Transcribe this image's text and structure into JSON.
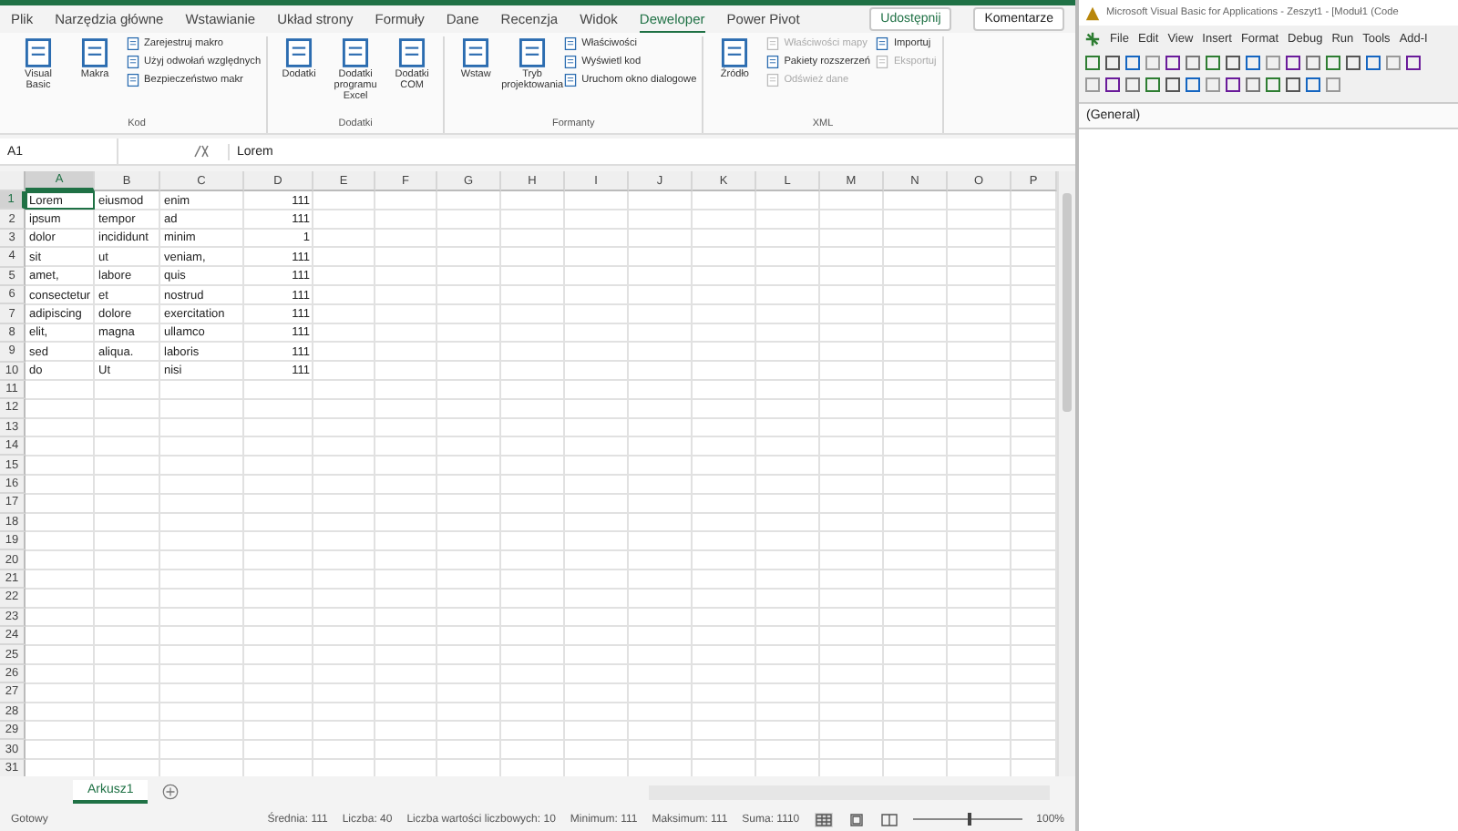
{
  "ribbon_tabs": [
    {
      "label": "Plik",
      "selected": false
    },
    {
      "label": "Narzędzia główne",
      "selected": false
    },
    {
      "label": "Wstawianie",
      "selected": false
    },
    {
      "label": "Układ strony",
      "selected": false
    },
    {
      "label": "Formuły",
      "selected": false
    },
    {
      "label": "Dane",
      "selected": false
    },
    {
      "label": "Recenzja",
      "selected": false
    },
    {
      "label": "Widok",
      "selected": false
    },
    {
      "label": "Deweloper",
      "selected": true
    },
    {
      "label": "Power Pivot",
      "selected": false
    }
  ],
  "share_button": "Udostępnij",
  "comments_button": "Komentarze",
  "ribbon_groups": [
    {
      "label": "Kod",
      "items": [
        {
          "label": "Visual Basic",
          "kind": "large",
          "disabled": false
        },
        {
          "label": "Makra",
          "kind": "large",
          "disabled": false
        },
        {
          "label": "Zarejestruj makro",
          "kind": "small",
          "disabled": false
        },
        {
          "label": "Użyj odwołań względnych",
          "kind": "small",
          "disabled": false
        },
        {
          "label": "Bezpieczeństwo makr",
          "kind": "small",
          "disabled": false
        }
      ]
    },
    {
      "label": "Dodatki",
      "items": [
        {
          "label": "Dodatki",
          "kind": "large",
          "disabled": false
        },
        {
          "label": "Dodatki programu Excel",
          "kind": "large",
          "disabled": false
        },
        {
          "label": "Dodatki COM",
          "kind": "large",
          "disabled": false
        }
      ]
    },
    {
      "label": "Formanty",
      "items": [
        {
          "label": "Wstaw",
          "kind": "large",
          "disabled": false
        },
        {
          "label": "Tryb projektowania",
          "kind": "large",
          "disabled": false
        },
        {
          "label": "Właściwości",
          "kind": "small",
          "disabled": false
        },
        {
          "label": "Wyświetl kod",
          "kind": "small",
          "disabled": false
        },
        {
          "label": "Uruchom okno dialogowe",
          "kind": "small",
          "disabled": false
        }
      ]
    },
    {
      "label": "XML",
      "items": [
        {
          "label": "Źródło",
          "kind": "large",
          "disabled": false
        },
        {
          "label": "Właściwości mapy",
          "kind": "small",
          "disabled": true
        },
        {
          "label": "Pakiety rozszerzeń",
          "kind": "small",
          "disabled": false
        },
        {
          "label": "Odśwież dane",
          "kind": "small",
          "disabled": true
        },
        {
          "label": "Importuj",
          "kind": "small",
          "disabled": false
        },
        {
          "label": "Eksportuj",
          "kind": "small",
          "disabled": true
        }
      ]
    }
  ],
  "formula_bar": {
    "name_box": "A1",
    "value": "Lorem"
  },
  "columns": [
    {
      "label": "A",
      "selected": true
    },
    {
      "label": "B",
      "selected": false
    },
    {
      "label": "C",
      "selected": false
    },
    {
      "label": "D",
      "selected": false
    },
    {
      "label": "E",
      "selected": false
    },
    {
      "label": "F",
      "selected": false
    },
    {
      "label": "G",
      "selected": false
    },
    {
      "label": "H",
      "selected": false
    },
    {
      "label": "I",
      "selected": false
    },
    {
      "label": "J",
      "selected": false
    },
    {
      "label": "K",
      "selected": false
    },
    {
      "label": "L",
      "selected": false
    },
    {
      "label": "M",
      "selected": false
    },
    {
      "label": "N",
      "selected": false
    },
    {
      "label": "O",
      "selected": false
    },
    {
      "label": "P",
      "selected": false
    }
  ],
  "rows": [
    {
      "number": "1",
      "selected": true,
      "cells": [
        "Lorem",
        "eiusmod",
        "enim",
        "111"
      ]
    },
    {
      "number": "2",
      "selected": false,
      "cells": [
        "ipsum",
        "tempor",
        "ad",
        "111"
      ]
    },
    {
      "number": "3",
      "selected": false,
      "cells": [
        "dolor",
        "incididunt",
        "minim",
        "1"
      ]
    },
    {
      "number": "4",
      "selected": false,
      "cells": [
        "sit",
        "ut",
        "veniam,",
        "111"
      ]
    },
    {
      "number": "5",
      "selected": false,
      "cells": [
        "amet,",
        "labore",
        "quis",
        "111"
      ]
    },
    {
      "number": "6",
      "selected": false,
      "cells": [
        "consectetur",
        "et",
        "nostrud",
        "111"
      ]
    },
    {
      "number": "7",
      "selected": false,
      "cells": [
        "adipiscing",
        "dolore",
        "exercitation",
        "111"
      ]
    },
    {
      "number": "8",
      "selected": false,
      "cells": [
        "elit,",
        "magna",
        "ullamco",
        "111"
      ]
    },
    {
      "number": "9",
      "selected": false,
      "cells": [
        "sed",
        "aliqua.",
        "laboris",
        "111"
      ]
    },
    {
      "number": "10",
      "selected": false,
      "cells": [
        "do",
        "Ut",
        "nisi",
        "111"
      ]
    },
    {
      "number": "11",
      "selected": false
    },
    {
      "number": "12",
      "selected": false
    },
    {
      "number": "13",
      "selected": false
    },
    {
      "number": "14",
      "selected": false
    },
    {
      "number": "15",
      "selected": false
    },
    {
      "number": "16",
      "selected": false
    },
    {
      "number": "17",
      "selected": false
    },
    {
      "number": "18",
      "selected": false
    },
    {
      "number": "19",
      "selected": false
    },
    {
      "number": "20",
      "selected": false
    },
    {
      "number": "21",
      "selected": false
    },
    {
      "number": "22",
      "selected": false
    },
    {
      "number": "23",
      "selected": false
    },
    {
      "number": "24",
      "selected": false
    },
    {
      "number": "25",
      "selected": false
    },
    {
      "number": "26",
      "selected": false
    },
    {
      "number": "27",
      "selected": false
    },
    {
      "number": "28",
      "selected": false
    },
    {
      "number": "29",
      "selected": false
    },
    {
      "number": "30",
      "selected": false
    },
    {
      "number": "31",
      "selected": false
    }
  ],
  "sheet_tabs": [
    {
      "label": "Arkusz1",
      "selected": true
    }
  ],
  "status_bar": {
    "mode": "Gotowy",
    "stats": [
      "Średnia: 111",
      "Liczba: 40",
      "Liczba wartości liczbowych: 10",
      "Minimum: 111",
      "Maksimum: 111",
      "Suma: 1110"
    ],
    "views": [
      {
        "kind": "normal",
        "selected": true
      },
      {
        "kind": "page_layout",
        "selected": false
      },
      {
        "kind": "page_break",
        "selected": false
      }
    ],
    "zoom": {
      "level": 0.5,
      "label": "100%"
    }
  },
  "vba": {
    "title": "Microsoft Visual Basic for Applications - Zeszyt1 - [Moduł1 (Code",
    "menu": [
      "File",
      "Edit",
      "View",
      "Insert",
      "Format",
      "Debug",
      "Run",
      "Tools",
      "Add-I"
    ],
    "object_box": "(General)"
  }
}
